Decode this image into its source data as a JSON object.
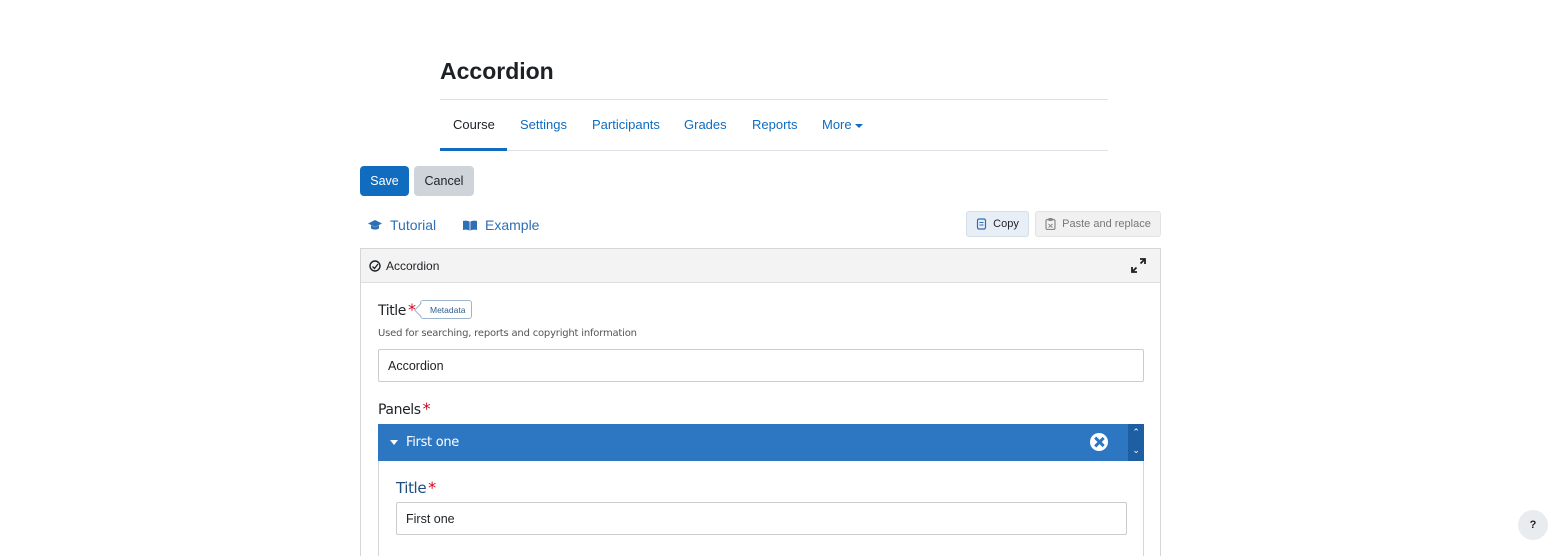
{
  "page": {
    "title": "Accordion"
  },
  "nav": {
    "items": [
      {
        "label": "Course"
      },
      {
        "label": "Settings"
      },
      {
        "label": "Participants"
      },
      {
        "label": "Grades"
      },
      {
        "label": "Reports"
      },
      {
        "label": "More"
      }
    ]
  },
  "actions": {
    "save_label": "Save",
    "cancel_label": "Cancel"
  },
  "hub_links": {
    "tutorial_label": "Tutorial",
    "example_label": "Example"
  },
  "clipboard": {
    "copy_label": "Copy",
    "paste_label": "Paste and replace"
  },
  "editor": {
    "content_type": "Accordion",
    "title_field": {
      "label": "Title",
      "required_mark": "*",
      "badge": "Metadata",
      "description": "Used for searching, reports and copyright information",
      "value": "Accordion"
    },
    "panels_label": "Panels",
    "panels": [
      {
        "header": "First one",
        "title_label": "Title",
        "title_value": "First one"
      }
    ]
  },
  "help": {
    "label": "?"
  },
  "colors": {
    "accent": "#0f6cbf",
    "panel_bar": "#2d77c2",
    "required": "#d0021b"
  }
}
